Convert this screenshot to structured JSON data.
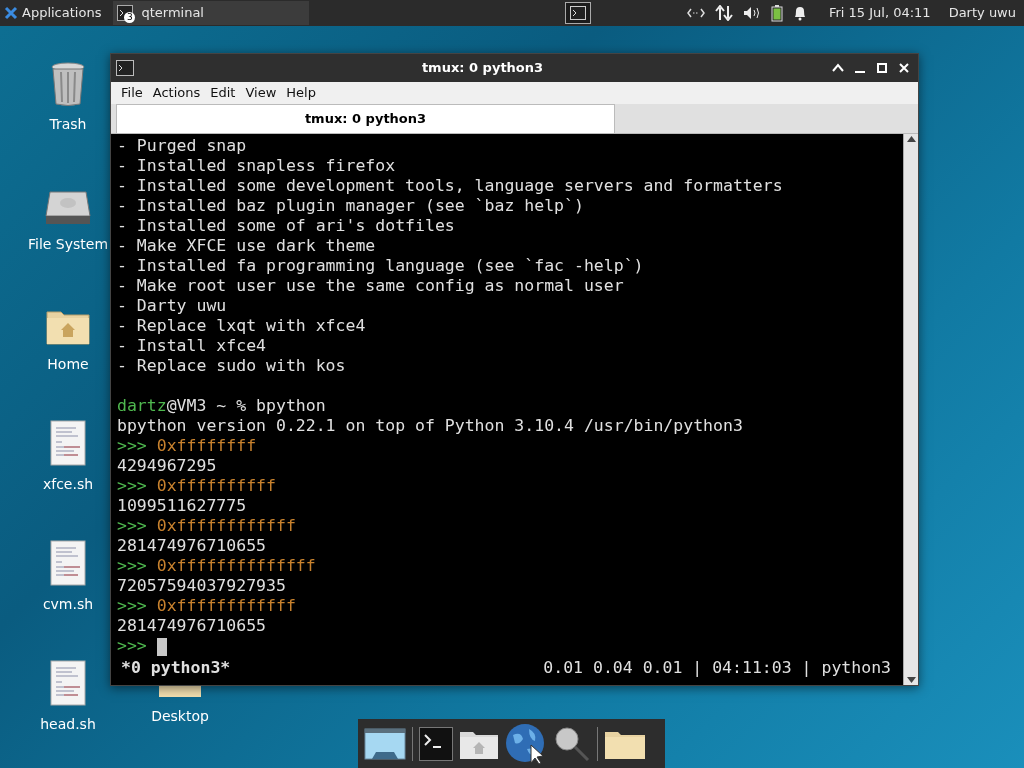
{
  "panel": {
    "apps_menu": "Applications",
    "tasks": [
      {
        "label": "qterminal",
        "badge": "3",
        "selected": true
      }
    ],
    "clock": "Fri 15 Jul, 04:11",
    "user": "Darty uwu"
  },
  "desktop_icons": [
    {
      "label": "Trash",
      "kind": "trash"
    },
    {
      "label": "File System",
      "kind": "drive"
    },
    {
      "label": "Home",
      "kind": "home"
    },
    {
      "label": "xfce.sh",
      "kind": "script"
    },
    {
      "label": "cvm.sh",
      "kind": "script"
    },
    {
      "label": "head.sh",
      "kind": "script"
    },
    {
      "label": "Desktop",
      "kind": "folder"
    }
  ],
  "window": {
    "title": "tmux: 0 python3",
    "menu": [
      "File",
      "Actions",
      "Edit",
      "View",
      "Help"
    ],
    "tabs": [
      {
        "label": "tmux: 0 python3",
        "selected": true
      }
    ],
    "lines": [
      [
        {
          "kind": "text",
          "text": "- Purged snap"
        }
      ],
      [
        {
          "kind": "text",
          "text": "- Installed snapless firefox"
        }
      ],
      [
        {
          "kind": "text",
          "text": "- Installed some development tools, language servers and formatters"
        }
      ],
      [
        {
          "kind": "text",
          "text": "- Installed baz plugin manager (see `baz help`)"
        }
      ],
      [
        {
          "kind": "text",
          "text": "- Installed some of ari's dotfiles"
        }
      ],
      [
        {
          "kind": "text",
          "text": "- Make XFCE use dark theme"
        }
      ],
      [
        {
          "kind": "text",
          "text": "- Installed fa programming language (see `fac -help`)"
        }
      ],
      [
        {
          "kind": "text",
          "text": "- Make root user use the same config as normal user"
        }
      ],
      [
        {
          "kind": "text",
          "text": "- Darty uwu"
        }
      ],
      [
        {
          "kind": "text",
          "text": "- Replace lxqt with xfce4"
        }
      ],
      [
        {
          "kind": "text",
          "text": "- Install xfce4"
        }
      ],
      [
        {
          "kind": "text",
          "text": "- Replace sudo with kos"
        }
      ],
      [
        {
          "kind": "blank"
        }
      ],
      [
        {
          "kind": "user",
          "text": "dartz"
        },
        {
          "kind": "text",
          "text": "@VM3 ~ % bpython"
        }
      ],
      [
        {
          "kind": "text",
          "text": "bpython version 0.22.1 on top of Python 3.10.4 /usr/bin/python3"
        }
      ],
      [
        {
          "kind": "prompt",
          "text": ">>>"
        },
        {
          "kind": "code",
          "text": "0xffffffff"
        }
      ],
      [
        {
          "kind": "text",
          "text": "4294967295"
        }
      ],
      [
        {
          "kind": "prompt",
          "text": ">>>"
        },
        {
          "kind": "code",
          "text": "0xffffffffff"
        }
      ],
      [
        {
          "kind": "text",
          "text": "1099511627775"
        }
      ],
      [
        {
          "kind": "prompt",
          "text": ">>>"
        },
        {
          "kind": "code",
          "text": "0xffffffffffff"
        }
      ],
      [
        {
          "kind": "text",
          "text": "281474976710655"
        }
      ],
      [
        {
          "kind": "prompt",
          "text": ">>>"
        },
        {
          "kind": "code",
          "text": "0xffffffffffffff"
        }
      ],
      [
        {
          "kind": "text",
          "text": "72057594037927935"
        }
      ],
      [
        {
          "kind": "prompt",
          "text": ">>>"
        },
        {
          "kind": "code",
          "text": "0xffffffffffff"
        }
      ],
      [
        {
          "kind": "text",
          "text": "281474976710655"
        }
      ],
      [
        {
          "kind": "prompt",
          "text": ">>>"
        },
        {
          "kind": "cursor"
        }
      ]
    ],
    "status_left": "*0 python3*",
    "status_right": "0.01 0.04 0.01 | 04:11:03 | python3"
  }
}
